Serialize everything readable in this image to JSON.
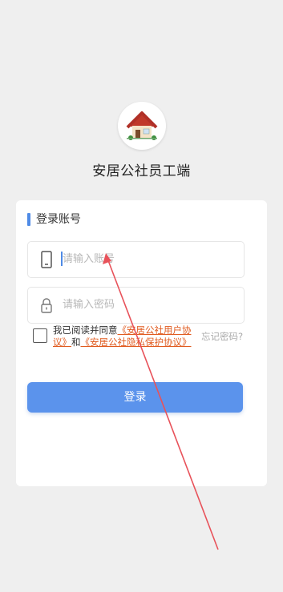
{
  "app": {
    "name": "安居公社员工端"
  },
  "login": {
    "section_title": "登录账号",
    "account_placeholder": "请输入账号",
    "password_placeholder": "请输入密码",
    "agree_prefix": "我已阅读并同意",
    "user_agreement": "《安居公社用户协议》",
    "agree_and": "和",
    "privacy_agreement": "《安居公社隐私保护协议》",
    "forgot_password": "忘记密码?",
    "login_button": "登录"
  },
  "colors": {
    "accent": "#5b93ec",
    "link": "#e05a1e",
    "background": "#efefef"
  },
  "icons": {
    "logo": "house-icon",
    "account": "phone-icon",
    "password": "lock-icon"
  }
}
